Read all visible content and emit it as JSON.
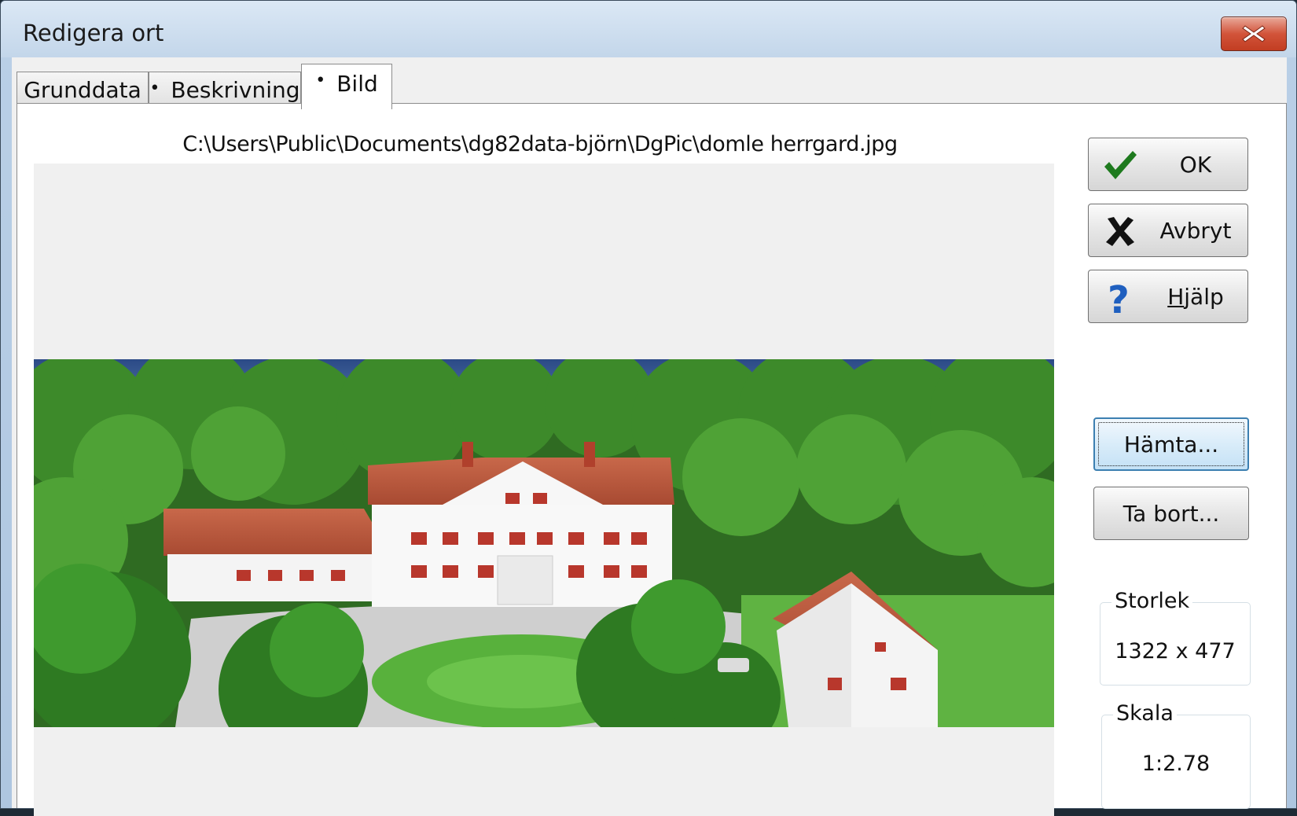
{
  "window": {
    "title": "Redigera ort"
  },
  "tabs": [
    {
      "label": "Grunddata",
      "bullet": ""
    },
    {
      "label": "Beskrivning",
      "bullet": "•"
    },
    {
      "label": "Bild",
      "bullet": "•"
    }
  ],
  "panel": {
    "file_path": "C:\\Users\\Public\\Documents\\dg82data-björn\\DgPic\\domle herrgard.jpg"
  },
  "buttons": {
    "ok": "OK",
    "cancel": "Avbryt",
    "help_hotkey": "H",
    "help_rest": "jälp",
    "fetch": "Hämta...",
    "remove": "Ta bort..."
  },
  "size_group": {
    "legend": "Storlek",
    "value": "1322 x 477"
  },
  "scale_group": {
    "legend": "Skala",
    "value": "1:2.78"
  },
  "colors": {
    "ok_check": "#1e7a1e",
    "help_question": "#1f5fbf",
    "close_button": "#c9452a"
  },
  "icons": {
    "ok": "checkmark-icon",
    "cancel": "x-icon",
    "help": "question-icon",
    "close": "close-icon"
  }
}
